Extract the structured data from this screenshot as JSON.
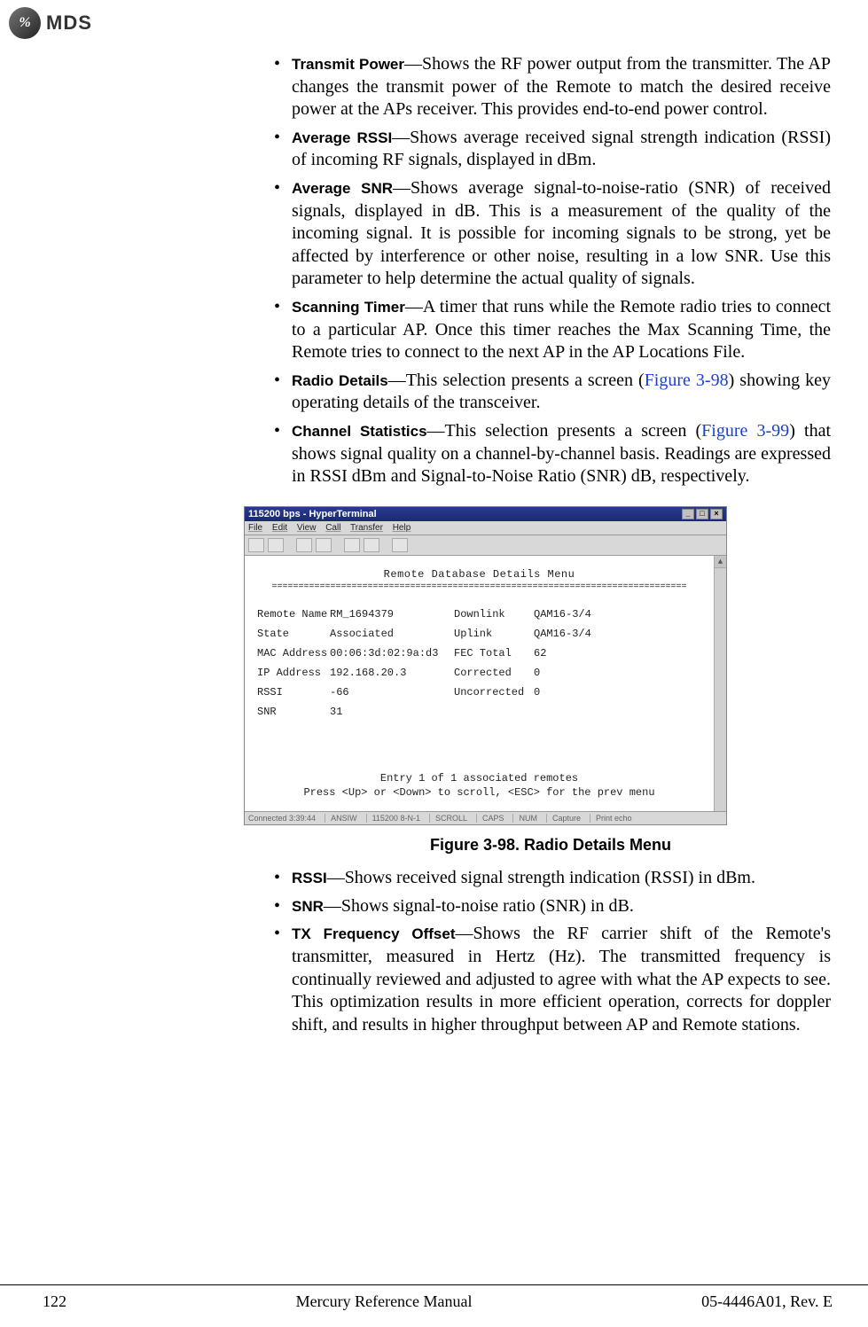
{
  "header": {
    "logo_text": "%",
    "brand": "MDS"
  },
  "bullets_top": [
    {
      "term": "Transmit Power",
      "text": "—Shows the RF power output from the transmitter. The AP changes the transmit power of the Remote to match the desired receive power at the APs receiver. This provides end-to-end power control."
    },
    {
      "term": "Average RSSI",
      "text": "—Shows average received signal strength indication (RSSI) of incoming RF signals, displayed in dBm."
    },
    {
      "term": "Average SNR",
      "text": "—Shows average signal-to-noise-ratio (SNR) of received signals, displayed in dB. This is a measurement of the quality of the incoming signal. It is possible for incoming signals to be strong, yet be affected by interference or other noise, resulting in a low SNR. Use this parameter to help determine the actual quality of signals."
    },
    {
      "term": "Scanning Timer",
      "text": "—A timer that runs while the Remote radio tries to connect to a particular AP. Once this timer reaches the Max Scanning Time, the Remote tries to connect to the next AP in the AP Locations File."
    },
    {
      "term": "Radio Details",
      "pre": "—This selection presents a screen (",
      "ref": "Figure 3-98",
      "post": ") showing key operating details of the transceiver."
    },
    {
      "term": "Channel Statistics",
      "pre": "—This selection presents a screen (",
      "ref": "Figure 3-99",
      "post": ") that shows signal quality on a channel-by-channel basis. Readings are expressed in RSSI dBm and Signal-to-Noise Ratio (SNR) dB, respectively."
    }
  ],
  "terminal": {
    "title": "115200 bps - HyperTerminal",
    "menu": [
      "File",
      "Edit",
      "View",
      "Call",
      "Transfer",
      "Help"
    ],
    "heading": "Remote Database Details Menu",
    "divider": "==============================================================================",
    "rows": [
      [
        "Remote Name",
        "RM_1694379",
        "Downlink",
        "QAM16-3/4"
      ],
      [
        "State",
        "Associated",
        "Uplink",
        "QAM16-3/4"
      ],
      [
        "MAC Address",
        "00:06:3d:02:9a:d3",
        "FEC Total",
        "62"
      ],
      [
        "IP Address",
        "192.168.20.3",
        "Corrected",
        "0"
      ],
      [
        "RSSI",
        "-66",
        "Uncorrected",
        "0"
      ],
      [
        "SNR",
        "31",
        "",
        ""
      ]
    ],
    "footer1": "Entry 1 of 1 associated remotes",
    "footer2": "Press <Up> or <Down> to scroll, <ESC> for the prev menu",
    "status": [
      "Connected 3:39:44",
      "ANSIW",
      "115200 8-N-1",
      "SCROLL",
      "CAPS",
      "NUM",
      "Capture",
      "Print echo"
    ]
  },
  "figure_caption": "Figure 3-98. Radio Details Menu",
  "bullets_bottom": [
    {
      "term": "RSSI",
      "text": "—Shows received signal strength indication (RSSI) in dBm."
    },
    {
      "term": "SNR",
      "text": "—Shows signal-to-noise ratio (SNR) in dB."
    },
    {
      "term": "TX Frequency Offset",
      "text": "—Shows the RF carrier shift of the Remote's transmitter, measured in Hertz (Hz). The transmitted frequency is continually reviewed and adjusted to agree with what the AP expects to see. This optimization results in more efficient operation, corrects for doppler shift, and results in higher throughput between AP and Remote stations."
    }
  ],
  "footer": {
    "left": "122",
    "center": "Mercury Reference Manual",
    "right": "05-4446A01, Rev. E"
  }
}
